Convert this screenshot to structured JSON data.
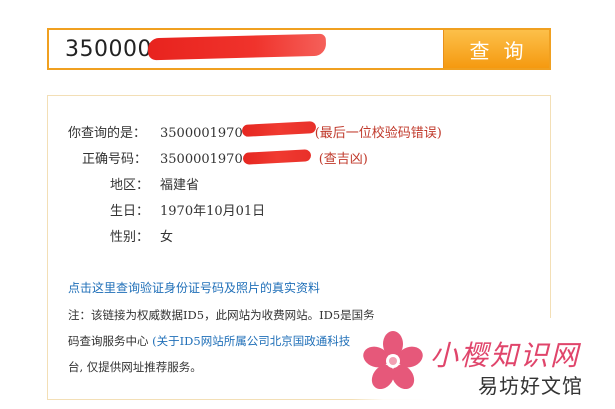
{
  "search": {
    "value": "3500001",
    "button_label": "查询"
  },
  "result": {
    "query_label": "你查询的是：",
    "query_value": "3500001970",
    "query_note": "(最后一位校验码错误)",
    "correct_label": "正确号码：",
    "correct_value": "3500001970",
    "correct_note": "(查吉凶)",
    "region_label": "地区：",
    "region_value": "福建省",
    "birthday_label": "生日：",
    "birthday_value": "1970年10月01日",
    "gender_label": "性别：",
    "gender_value": "女"
  },
  "link": {
    "text": "点击这里查询验证身份证号码及照片的真实资料"
  },
  "note": {
    "line1": "注：该链接为权威数据ID5，此网站为收费网站。ID5是国",
    "line1_tail": "务",
    "line2_start": "码查询服务中心",
    "line2_link": "(关于ID5网站所属公司北京国政通科技",
    "line3": "台, 仅提供网址推荐服务。"
  },
  "watermark": {
    "title": "小樱知识网",
    "subtitle": "易坊好文馆"
  },
  "colors": {
    "accent": "#f5a623",
    "link": "#1f6fb8",
    "error": "#c0392b"
  }
}
